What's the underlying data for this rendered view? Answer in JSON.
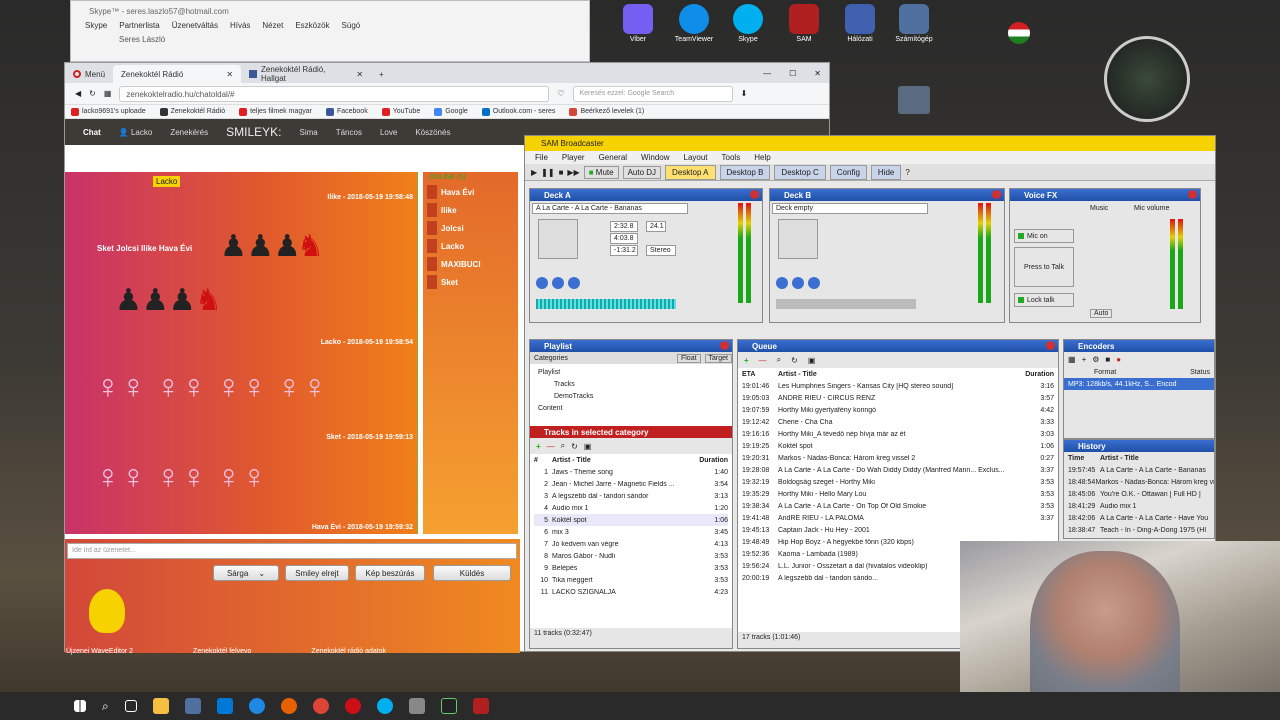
{
  "skype": {
    "title": "Skype™ - seres.laszlo57@hotmail.com",
    "menu": [
      "Skype",
      "Partnerlista",
      "Üzenetváltás",
      "Hívás",
      "Nézet",
      "Eszközök",
      "Súgó"
    ],
    "contact": "Seres László"
  },
  "desktop_icons": [
    {
      "label": "Viber",
      "color": "#7360f2"
    },
    {
      "label": "TeamViewer",
      "color": "#0e8ee9"
    },
    {
      "label": "Skype",
      "color": "#00aff0"
    },
    {
      "label": "SAM",
      "color": "#b02020"
    },
    {
      "label": "Hálózati",
      "color": "#4060b0"
    },
    {
      "label": "Számítógép",
      "color": "#5070a0"
    }
  ],
  "browser": {
    "menu_label": "Menü",
    "tabs": [
      {
        "label": "Zenekoktél Rádió",
        "active": true
      },
      {
        "label": "Zenekoktél Rádió, Hallgat",
        "active": false
      }
    ],
    "url": "zenekoktelradio.hu/chatoldal/#",
    "search_placeholder": "Keresés ezzel: Google Search",
    "bookmarks": [
      "lacko9691's uploade",
      "Zenekoktél Rádió",
      "teljes filmek magyar",
      "Facebook",
      "YouTube",
      "Google",
      "Outlook.com - seres",
      "Beérkező levelek (1)"
    ]
  },
  "chat": {
    "nav": [
      "Chat",
      "Lacko",
      "Zenekérés",
      "SMILEYK:",
      "Sima",
      "Táncos",
      "Love",
      "Köszönés"
    ],
    "highlight_user": "Lacko",
    "messages": [
      {
        "meta": "Ilike - 2018-05-19 19:58:48",
        "text": "Sket Jolcsi Ilike Hava Évi"
      },
      {
        "meta": "Lacko - 2018-05-19 19:58:54"
      },
      {
        "meta": "Sket - 2018-05-19 19:59:13"
      },
      {
        "meta": "Hava Évi - 2018-05-19 19:59:32"
      }
    ],
    "online_label": "ONLINE (5)",
    "users": [
      "Hava Évi",
      "Ilike",
      "Jolcsi",
      "Lacko",
      "MAXIBUCI",
      "Sket"
    ],
    "input_placeholder": "Ide írd az üzenetet...",
    "color_select": "Sárga",
    "buttons": {
      "smiley": "Smiley elrejt",
      "image": "Kép beszúrás",
      "send": "Küldés"
    }
  },
  "sam": {
    "title": "SAM Broadcaster",
    "menu": [
      "File",
      "Player",
      "General",
      "Window",
      "Layout",
      "Tools",
      "Help"
    ],
    "toolbar": {
      "mute": "Mute",
      "agc": "Auto DJ",
      "desktops": [
        "Desktop A",
        "Desktop B",
        "Desktop C"
      ],
      "config": "Config",
      "hide": "Hide",
      "help": "?"
    },
    "deck_a": {
      "title": "Deck A",
      "track": "A La Carte - A La Carte - Bananas",
      "cur": "2:32.8",
      "dur": "4:03.8",
      "rem": "-1:31.2",
      "kbps": "24.1",
      "stereo": "Stereo"
    },
    "deck_b": {
      "title": "Deck B",
      "track": "Deck empty"
    },
    "voicefx": {
      "title": "Voice FX",
      "mic": "Mic on",
      "talk": "Press to Talk",
      "lock": "Lock talk",
      "music": "Music",
      "mic_vol": "Mic volume",
      "auto": "Auto"
    },
    "playlist": {
      "title": "Playlist",
      "categories_label": "Categories",
      "float": "Float",
      "target": "Target",
      "tree": [
        "Playlist",
        "Tracks",
        "DemoTracks",
        "Content"
      ],
      "tracks_header": "Tracks in selected category",
      "columns": [
        "#",
        "Artist - Title",
        "Duration"
      ],
      "tracks": [
        [
          "1",
          "Jaws - Theme song",
          "1:40"
        ],
        [
          "2",
          "Jean - Michel Jarre - Magnetic Fields ...",
          "3:54"
        ],
        [
          "3",
          "A legszebb dal - tandori sándor",
          "3:13"
        ],
        [
          "4",
          "Audio mix 1",
          "1:20"
        ],
        [
          "5",
          "Koktél spot",
          "1:06"
        ],
        [
          "6",
          "mix 3",
          "3:45"
        ],
        [
          "7",
          "Jó kedvem van végre",
          "4:13"
        ],
        [
          "8",
          "Maros Gábor - Nudli",
          "3:53"
        ],
        [
          "9",
          "Belépés",
          "3:53"
        ],
        [
          "10",
          "Tika meggert",
          "3:53"
        ],
        [
          "11",
          "LACKÓ SZIGNÁLJA",
          "4:23"
        ]
      ],
      "footer": "11 tracks (0:32:47)"
    },
    "queue": {
      "title": "Queue",
      "columns": [
        "ETA",
        "Artist - Title",
        "Duration"
      ],
      "rows": [
        [
          "19:01:46",
          "Les Humphries Singers - Kansas City [HQ stereo sound]",
          "3:16"
        ],
        [
          "19:05:03",
          "ANDRÉ RIEU - CIRCUS RENZ",
          "3:57"
        ],
        [
          "19:07:59",
          "Horthy Miki gyertyafény koringó",
          "4:42"
        ],
        [
          "19:12:42",
          "Cherie - Cha Cha",
          "3:33"
        ],
        [
          "19:16:16",
          "Horthy Miki_A tévedő nép hívja már az ét",
          "3:03"
        ],
        [
          "19:19:25",
          "Koktél spot",
          "1:06"
        ],
        [
          "19:20:31",
          "Markos - Nádas-Bonca: Három kreg vissel 2",
          "0:27"
        ],
        [
          "19:28:08",
          "A La Carte - A La Carte - Do Wah Diddy Diddy (Manfred Mann... Exclus...",
          "3:37"
        ],
        [
          "19:32:19",
          "Boldogság szeget - Horthy Miki",
          "3:53"
        ],
        [
          "19:35:29",
          "Horthy Miki - Hello Mary Lou",
          "3:53"
        ],
        [
          "19:38:34",
          "A La Carte - A La Carte - On Top Of Old Smokie",
          "3:53"
        ],
        [
          "19:41:48",
          "AndRÉ RIEU - LA PALOMA",
          "3:37"
        ],
        [
          "19:45:13",
          "Captain Jack - Hu Hey - 2001",
          ""
        ],
        [
          "19:48:49",
          "Hip Hop Boyz - A hegyekbe fönn (320 kbps)",
          ""
        ],
        [
          "19:52:36",
          "Kaoma - Lambada (1989)",
          ""
        ],
        [
          "19:56:24",
          "L.L. Junior - Összetart a dal (hivatalos videoklip)",
          ""
        ],
        [
          "20:00:19",
          "A legszebb dal - tandori sándo...",
          ""
        ]
      ],
      "footer": "17 tracks (1:01:46)"
    },
    "encoders": {
      "title": "Encoders",
      "columns": [
        "Format",
        "Status"
      ],
      "row": "MP3: 128kb/s, 44.1kHz, S... Encod"
    },
    "history": {
      "title": "History",
      "columns": [
        "Time",
        "Artist - Title"
      ],
      "rows": [
        [
          "19:57:45",
          "A La Carte - A La Carte - Bananas"
        ],
        [
          "18:48:54",
          "Markos - Nádas-Bonca: Három kreg vissel 1"
        ],
        [
          "18:45:06",
          "You're O.K. - Ottawan [ Full HD ]"
        ],
        [
          "18:41:29",
          "Audio mix 1"
        ],
        [
          "18:42:06",
          "A La Carte - A La Carte - Have You"
        ],
        [
          "18:38:47",
          "Teach - In - Ding-A-Dong 1975 (HI"
        ]
      ]
    }
  },
  "desktop_bottom_labels": [
    "Újzenei WaveEditor 2",
    "Zenekoktél felvevo",
    "Zenekoktél rádió adatok"
  ]
}
